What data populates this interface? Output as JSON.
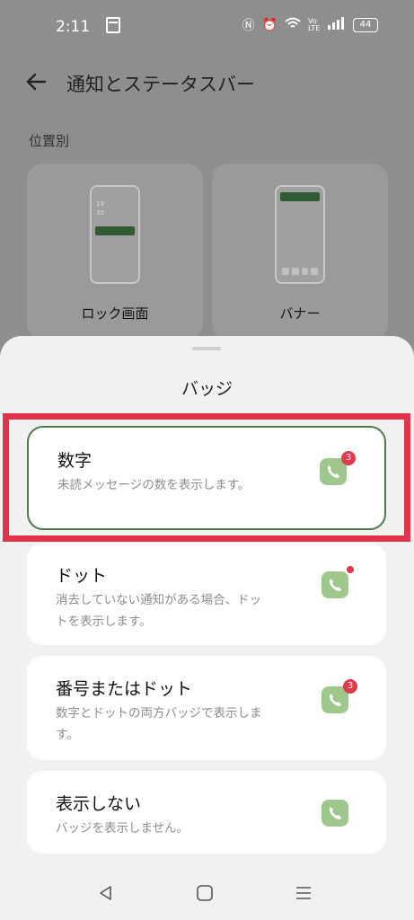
{
  "status": {
    "time": "2:11",
    "battery": "44",
    "volte": "Vo LTE"
  },
  "header": {
    "title": "通知とステータスバー"
  },
  "section": {
    "label": "位置別",
    "cards": [
      {
        "label": "ロック画面",
        "clock_line1": "19",
        "clock_line2": "30"
      },
      {
        "label": "バナー"
      }
    ]
  },
  "sheet": {
    "title": "バッジ",
    "options": [
      {
        "title": "数字",
        "desc": "未読メッセージの数を表示します。",
        "badge": "3",
        "selected": true
      },
      {
        "title": "ドット",
        "desc": "消去していない通知がある場合、ドットを表示します。",
        "badge": "dot",
        "selected": false
      },
      {
        "title": "番号またはドット",
        "desc": "数字とドットの両方バッジで表示します。",
        "badge": "3",
        "selected": false
      },
      {
        "title": "表示しない",
        "desc": "バッジを表示しません。",
        "badge": "none",
        "selected": false
      }
    ]
  },
  "colors": {
    "accent_green": "#4b7a4f",
    "badge_red": "#e13a4a",
    "highlight_red": "#e3334a"
  }
}
